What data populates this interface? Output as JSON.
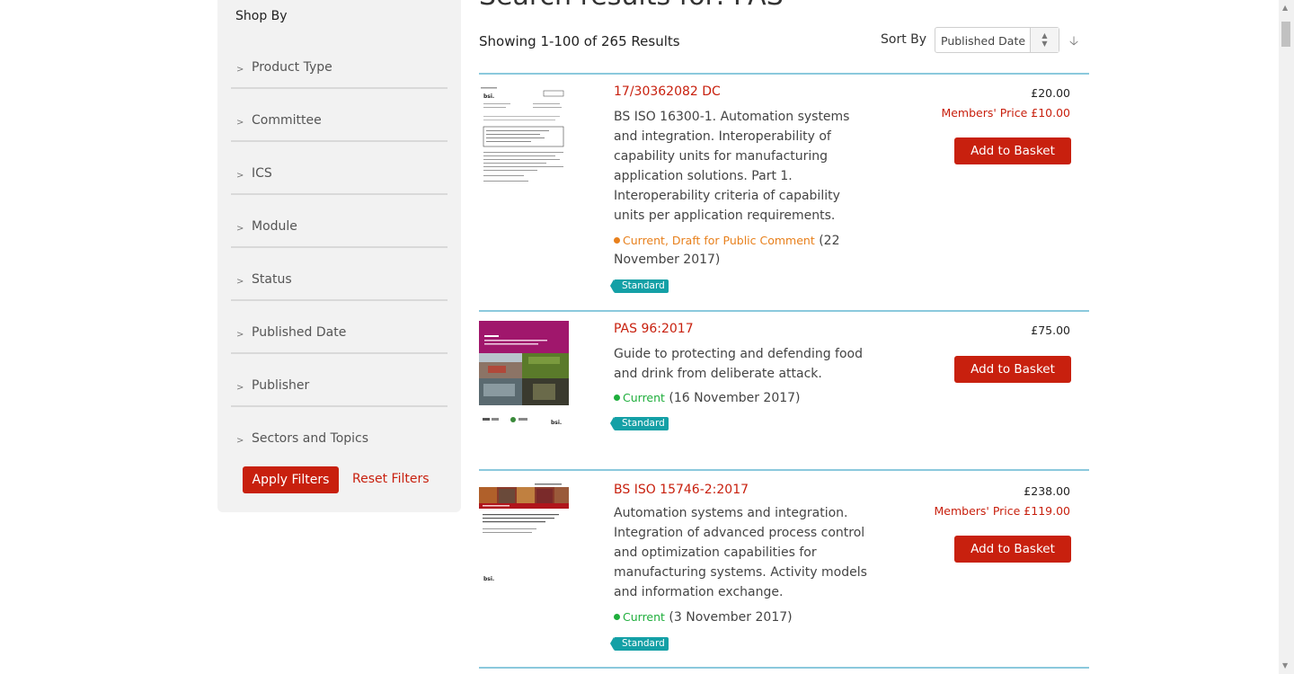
{
  "page": {
    "heading": "Search results for: PAS",
    "showing": "Showing 1-100 of 265 Results",
    "sort_label": "Sort By",
    "sort_value": "Published Date"
  },
  "sidebar": {
    "title": "Shop By",
    "facets": [
      "Product Type",
      "Committee",
      "ICS",
      "Module",
      "Status",
      "Published Date",
      "Publisher",
      "Sectors and Topics"
    ],
    "apply_label": "Apply Filters",
    "reset_label": "Reset Filters"
  },
  "results": [
    {
      "title": "17/30362082 DC",
      "description": "BS ISO 16300-1. Automation systems and integration. Interoperability of capability units for manufacturing application solutions. Part 1. Interoperability criteria of capability units per application requirements.",
      "status": "Current, Draft for Public Comment",
      "date": "(22 November 2017)",
      "tag": "Standard",
      "price": "£20.00",
      "member_price": "Members' Price £10.00",
      "basket_label": "Add to Basket"
    },
    {
      "title": "PAS 96:2017",
      "description": "Guide to protecting and defending food and drink from deliberate attack.",
      "status": "Current",
      "date": "(16 November 2017)",
      "tag": "Standard",
      "price": "£75.00",
      "member_price": "",
      "basket_label": "Add to Basket"
    },
    {
      "title": "BS ISO 15746-2:2017",
      "description": "Automation systems and integration. Integration of advanced process control and optimization capabilities for manufacturing systems. Activity models and information exchange.",
      "status": "Current",
      "date": "(3 November 2017)",
      "tag": "Standard",
      "price": "£238.00",
      "member_price": "Members' Price £119.00",
      "basket_label": "Add to Basket"
    }
  ],
  "colors": {
    "accent_red": "#c8200e",
    "divider_blue": "#8bc9dd",
    "tag_teal": "#14a0a6",
    "status_orange": "#e8801c",
    "status_green": "#1fae3c"
  }
}
